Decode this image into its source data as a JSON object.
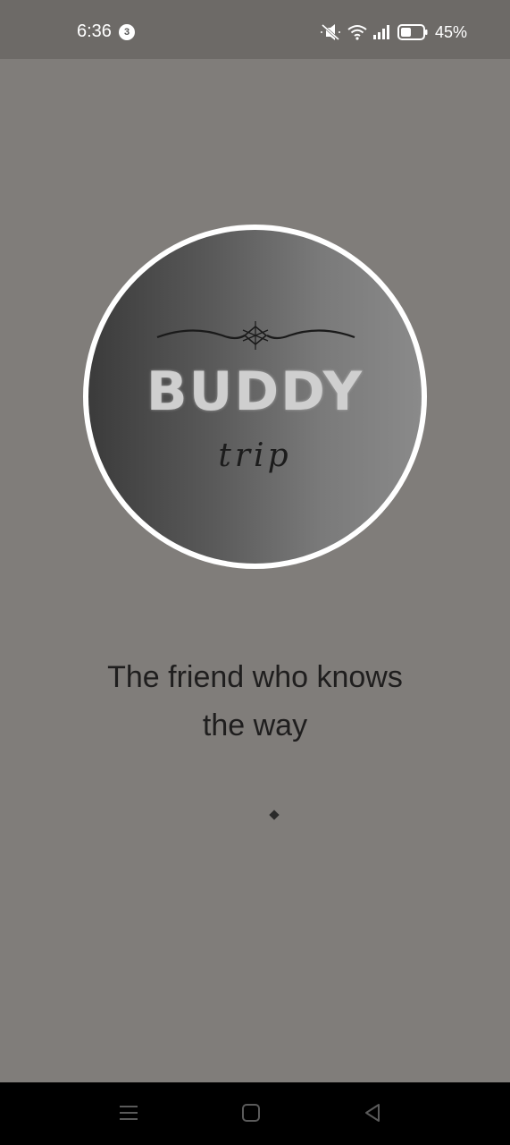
{
  "status_bar": {
    "time": "6:36",
    "notification_count": "3",
    "battery_percent": "45%",
    "icons": [
      "mute-icon",
      "wifi-icon",
      "signal-icon",
      "battery-icon"
    ]
  },
  "logo": {
    "title": "BUDDY",
    "subtitle": "trip"
  },
  "tagline": {
    "line1": "The friend who knows",
    "line2": "the way"
  },
  "nav_bar": {
    "icons": [
      "menu-icon",
      "home-icon",
      "back-icon"
    ]
  },
  "colors": {
    "background": "#807d7a",
    "status_bar": "#6d6a67",
    "nav_bar": "#000000"
  }
}
